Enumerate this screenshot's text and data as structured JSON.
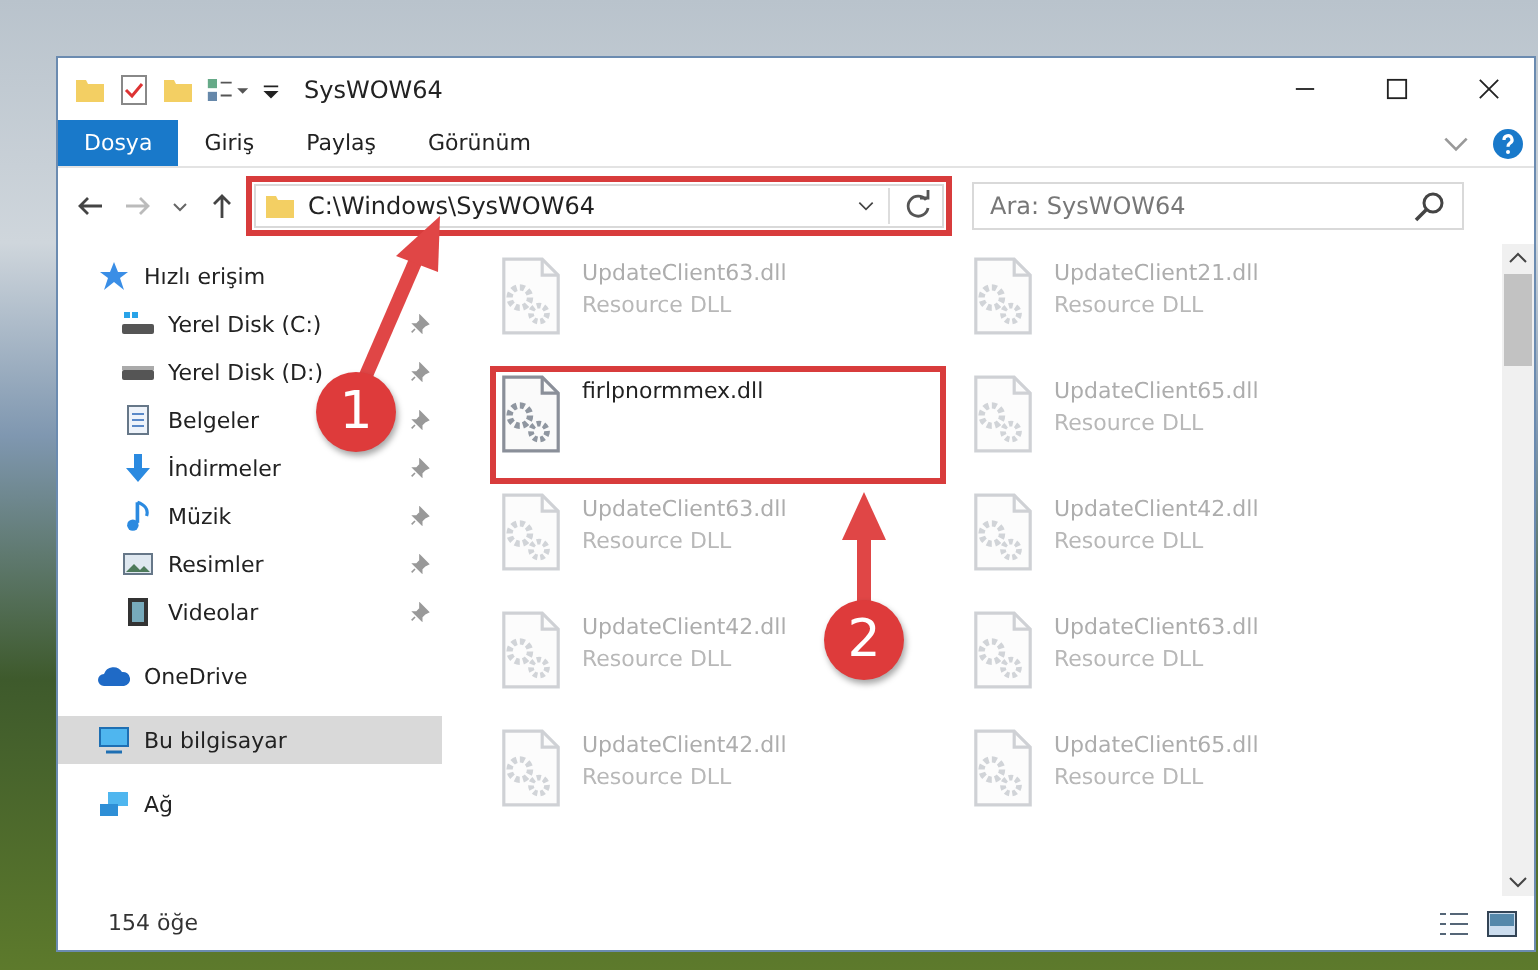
{
  "window": {
    "title": "SysWOW64"
  },
  "ribbon_tabs": [
    {
      "label": "Dosya",
      "selected": true
    },
    {
      "label": "Giriş",
      "selected": false
    },
    {
      "label": "Paylaş",
      "selected": false
    },
    {
      "label": "Görünüm",
      "selected": false
    }
  ],
  "address_bar": {
    "path": "C:\\Windows\\SysWOW64",
    "highlighted": true
  },
  "search": {
    "placeholder": "Ara: SysWOW64"
  },
  "sidebar": {
    "items": [
      {
        "label": "Hızlı erişim",
        "selected": false,
        "children": [
          {
            "label": "Yerel Disk (C:)",
            "pinned": true
          },
          {
            "label": "Yerel Disk (D:)",
            "pinned": true
          },
          {
            "label": "Belgeler",
            "pinned": true
          },
          {
            "label": "İndirmeler",
            "pinned": true
          },
          {
            "label": "Müzik",
            "pinned": true
          },
          {
            "label": "Resimler",
            "pinned": true
          },
          {
            "label": "Videolar",
            "pinned": true
          }
        ]
      },
      {
        "label": "OneDrive",
        "selected": false
      },
      {
        "label": "Bu bilgisayar",
        "selected": true
      },
      {
        "label": "Ağ",
        "selected": false
      }
    ]
  },
  "files": [
    {
      "name": "UpdateClient63.dll",
      "type": "Resource DLL",
      "blurred": true,
      "highlighted": false
    },
    {
      "name": "UpdateClient21.dll",
      "type": "Resource DLL",
      "blurred": true,
      "highlighted": false
    },
    {
      "name": "firlpnormmex.dll",
      "blurred": false,
      "highlighted": true
    },
    {
      "name": "UpdateClient65.dll",
      "type": "Resource DLL",
      "blurred": true,
      "highlighted": false
    },
    {
      "name": "UpdateClient63.dll",
      "type": "Resource DLL",
      "blurred": true,
      "highlighted": false
    },
    {
      "name": "UpdateClient42.dll",
      "type": "Resource DLL",
      "blurred": true,
      "highlighted": false
    },
    {
      "name": "UpdateClient42.dll",
      "type": "Resource DLL",
      "blurred": true,
      "highlighted": false
    },
    {
      "name": "UpdateClient63.dll",
      "type": "Resource DLL",
      "blurred": true,
      "highlighted": false
    },
    {
      "name": "UpdateClient42.dll",
      "type": "Resource DLL",
      "blurred": true,
      "highlighted": false
    },
    {
      "name": "UpdateClient65.dll",
      "type": "Resource DLL",
      "blurred": true,
      "highlighted": false
    }
  ],
  "status_bar": {
    "item_count": "154 öğe"
  },
  "annotations": [
    {
      "label": "1"
    },
    {
      "label": "2"
    }
  ]
}
